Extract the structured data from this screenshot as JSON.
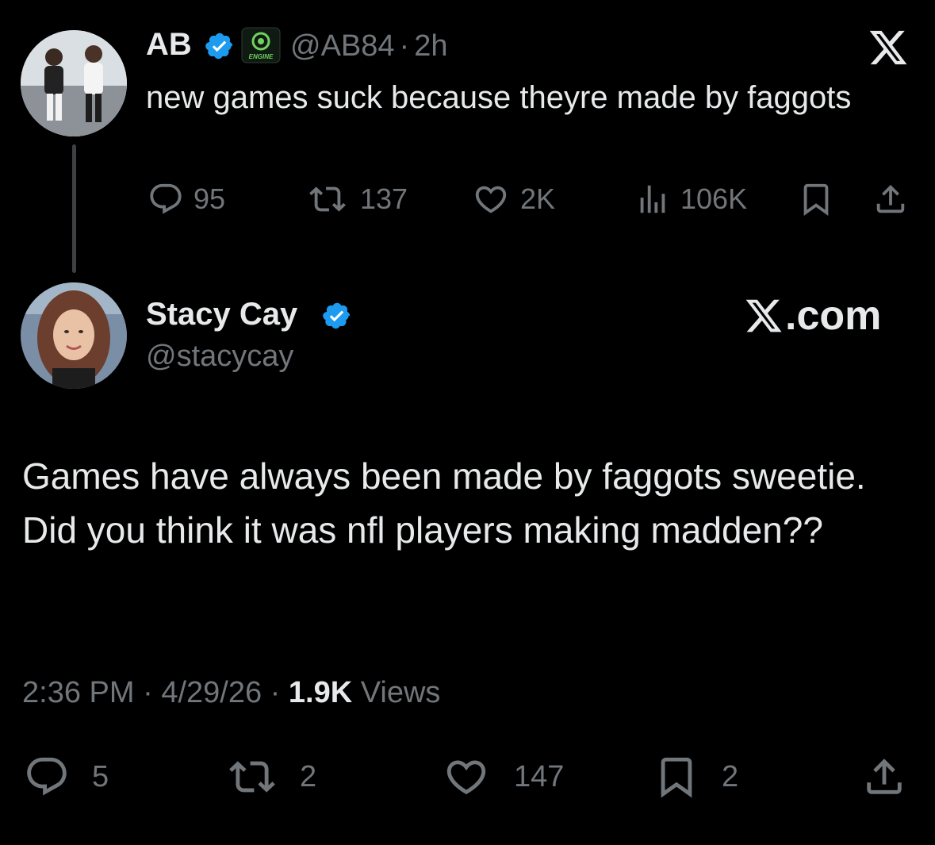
{
  "parent_tweet": {
    "author_name": "AB",
    "badge_text": "ENGINE",
    "handle": "@AB84",
    "separator": "·",
    "age": "2h",
    "text": "new games suck because theyre made by faggots",
    "replies": "95",
    "reposts": "137",
    "likes": "2K",
    "views": "106K",
    "icons": [
      "verified-badge-icon",
      "engine-badge-icon",
      "x-logo-icon",
      "reply-icon",
      "repost-icon",
      "like-icon",
      "views-icon",
      "bookmark-icon",
      "share-icon"
    ]
  },
  "reply": {
    "author_name": "Stacy Cay",
    "handle": "@stacycay",
    "watermark": ".com",
    "text": "Games have always been made by faggots sweetie. Did you think it was nfl players making madden??",
    "time": "2:36 PM",
    "date": "4/29/26",
    "separator": "·",
    "views_count": "1.9K",
    "views_label": "Views",
    "replies": "5",
    "reposts": "2",
    "likes": "147",
    "bookmarks": "2"
  },
  "colors": {
    "background": "#000000",
    "text": "#e7e9ea",
    "muted": "#71767b",
    "verified": "#1d9bf0",
    "thread_line": "#3e4144"
  }
}
